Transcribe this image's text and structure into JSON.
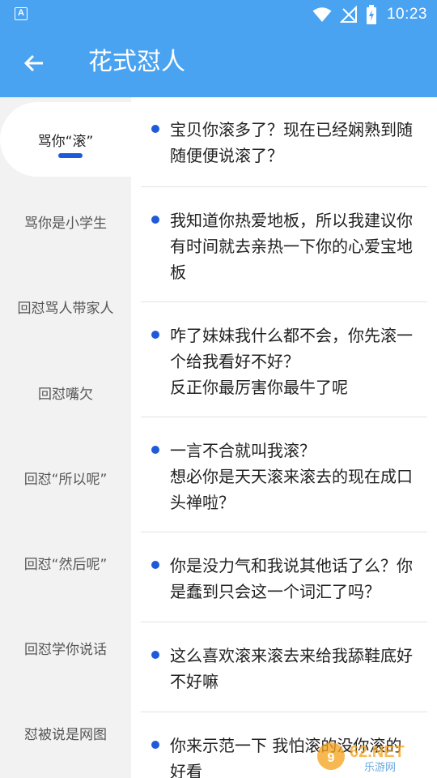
{
  "status_bar": {
    "app_icon": "A",
    "time": "10:23",
    "icons": [
      "wifi-icon",
      "no-signal-icon",
      "battery-charging-icon"
    ]
  },
  "app_bar": {
    "title": "花式怼人",
    "back_icon": "arrow-left-icon"
  },
  "sidebar": {
    "items": [
      {
        "label": "骂你“滚”",
        "active": true
      },
      {
        "label": "骂你是小学生"
      },
      {
        "label": "回怼骂人带家人"
      },
      {
        "label": "回怼嘴欠"
      },
      {
        "label": "回怼“所以呢”"
      },
      {
        "label": "回怼“然后呢”"
      },
      {
        "label": "回怼学你说话"
      },
      {
        "label": "怼被说是网图"
      }
    ],
    "accent_color": "#1f5bd9"
  },
  "content": {
    "items": [
      {
        "text": "宝贝你滚多了？现在已经娴熟到随\n随便便说滚了？"
      },
      {
        "text": "我知道你热爱地板，所以我建议你\n有时间就去亲热一下你的心爱宝地\n板"
      },
      {
        "text": "咋了妹妹我什么都不会，你先滚一\n个给我看好不好？\n反正你最厉害你最牛了呢"
      },
      {
        "text": "一言不合就叫我滚？\n想必你是天天滚来滚去的现在成口\n头禅啦？"
      },
      {
        "text": "你是没力气和我说其他话了么？你\n是蠢到只会这一个词汇了吗？"
      },
      {
        "text": "这么喜欢滚来滚去来给我舔鞋底好\n不好嘛"
      },
      {
        "text": "你来示范一下 我怕滚的没你滚的\n好看"
      }
    ]
  },
  "watermark": {
    "brand": "962.NET",
    "sub": "乐游网"
  },
  "colors": {
    "primary": "#4aa3f0",
    "sidebar_bg": "#f2f2f2",
    "bullet": "#1f5bd9"
  }
}
